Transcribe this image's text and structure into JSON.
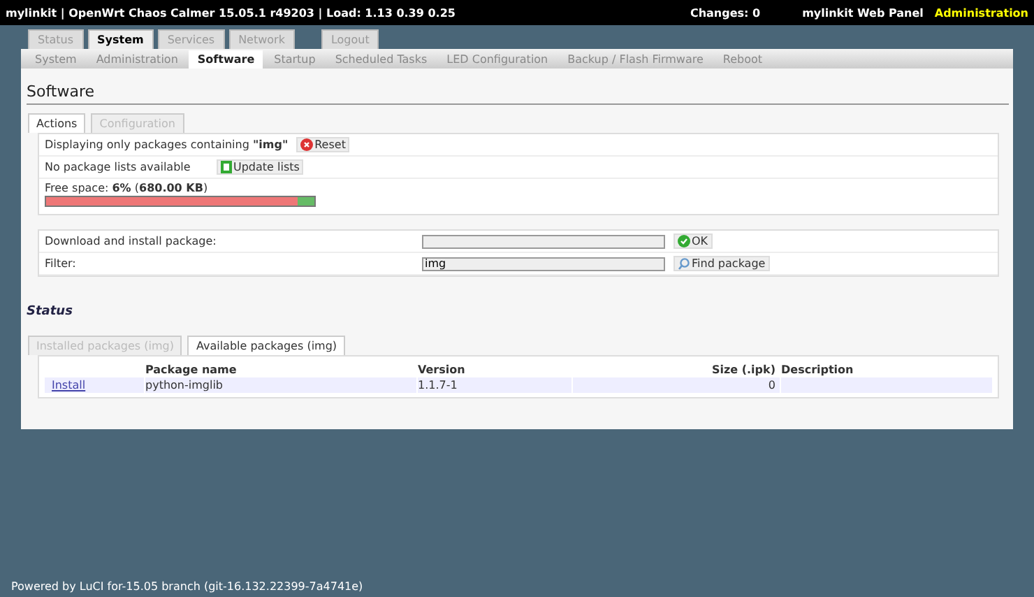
{
  "header": {
    "title": "mylinkit | OpenWrt Chaos Calmer 15.05.1 r49203 | Load: 1.13 0.39 0.25",
    "changes": "Changes: 0",
    "panel": "mylinkit Web Panel",
    "mode": "Administration"
  },
  "main_tabs": [
    {
      "label": "Status",
      "selected": false
    },
    {
      "label": "System",
      "selected": true
    },
    {
      "label": "Services",
      "selected": false
    },
    {
      "label": "Network",
      "selected": false
    },
    {
      "label": "Logout",
      "selected": false
    }
  ],
  "sub_tabs": [
    {
      "label": "System",
      "selected": false
    },
    {
      "label": "Administration",
      "selected": false
    },
    {
      "label": "Software",
      "selected": true
    },
    {
      "label": "Startup",
      "selected": false
    },
    {
      "label": "Scheduled Tasks",
      "selected": false
    },
    {
      "label": "LED Configuration",
      "selected": false
    },
    {
      "label": "Backup / Flash Firmware",
      "selected": false
    },
    {
      "label": "Reboot",
      "selected": false
    }
  ],
  "page_title": "Software",
  "section_tabs": [
    {
      "label": "Actions",
      "selected": true
    },
    {
      "label": "Configuration",
      "selected": false
    }
  ],
  "filter_info": {
    "text": "Displaying only packages containing **\"img\"**",
    "button": "Reset"
  },
  "lists_info": {
    "text": "No package lists available",
    "button": "Update lists"
  },
  "free_space": {
    "text": "Free space: **6%** (**680.00 KB**)",
    "level": 0.94
  },
  "download": {
    "label": "Download and install package:",
    "button": "OK"
  },
  "filter": {
    "label": "Filter:",
    "value": "img",
    "button": "Find package"
  },
  "status_title": "Status",
  "package_tabs": [
    {
      "label": "Installed packages (img)",
      "selected": false
    },
    {
      "label": "Available packages (img)",
      "selected": true
    }
  ],
  "table": {
    "columns": [
      "Package name",
      "Version",
      "Size (.ipk)",
      "Description"
    ],
    "rows": [
      {
        "action": "Install",
        "name": "python-imglib",
        "version": "1.1.7-1",
        "size": "0"
      }
    ]
  },
  "footer": "Powered by LuCI for-15.05 branch (git-16.132.22399-7a4741e)"
}
